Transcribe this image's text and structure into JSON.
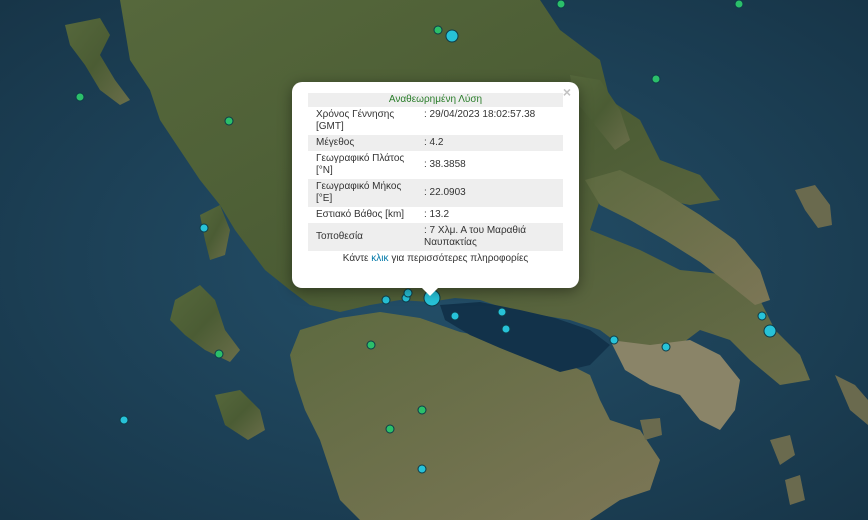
{
  "popup": {
    "title": "Αναθεωρημένη Λύση",
    "close_symbol": "×",
    "rows": [
      {
        "label": "Χρόνος Γέννησης [GMT]",
        "value": ": 29/04/2023 18:02:57.38"
      },
      {
        "label": "Μέγεθος",
        "value": ": 4.2"
      },
      {
        "label": "Γεωγραφικό Πλάτος [°N]",
        "value": ": 38.3858"
      },
      {
        "label": "Γεωγραφικό Μήκος [°E]",
        "value": ": 22.0903"
      },
      {
        "label": "Εστιακό Βάθος [km]",
        "value": ": 13.2"
      },
      {
        "label": "Τοποθεσία",
        "value": ": 7 Χλμ. Α του Μαραθιά Ναυπακτίας"
      }
    ],
    "more_prefix": "Κάντε",
    "more_link": "κλικ",
    "more_suffix": "για περισσότερες πληροφορίες"
  },
  "colors": {
    "sea": "#1d4258",
    "land": "#4f6038",
    "marker_cyan": "#27c2d8",
    "marker_green": "#2bbf6a",
    "popup_title": "#2a7d2a",
    "link": "#0078a8"
  },
  "markers": [
    {
      "color": "cyan",
      "selected": true
    },
    {
      "color": "cyan",
      "selected": false
    },
    {
      "color": "cyan",
      "selected": false
    },
    {
      "color": "cyan",
      "selected": false
    },
    {
      "color": "cyan",
      "selected": false
    },
    {
      "color": "cyan",
      "selected": false
    },
    {
      "color": "cyan",
      "selected": false
    },
    {
      "color": "cyan",
      "selected": false
    },
    {
      "color": "cyan",
      "selected": false
    },
    {
      "color": "cyan",
      "selected": false
    },
    {
      "color": "cyan",
      "selected": false
    },
    {
      "color": "cyan",
      "selected": false
    },
    {
      "color": "cyan",
      "selected": false
    },
    {
      "color": "cyan",
      "selected": false
    },
    {
      "color": "cyan",
      "selected": false
    },
    {
      "color": "green",
      "selected": false
    },
    {
      "color": "green",
      "selected": false
    },
    {
      "color": "green",
      "selected": false
    },
    {
      "color": "green",
      "selected": false
    },
    {
      "color": "green",
      "selected": false
    },
    {
      "color": "green",
      "selected": false
    },
    {
      "color": "green",
      "selected": false
    },
    {
      "color": "green",
      "selected": false
    },
    {
      "color": "green",
      "selected": false
    },
    {
      "color": "green",
      "selected": false
    }
  ]
}
